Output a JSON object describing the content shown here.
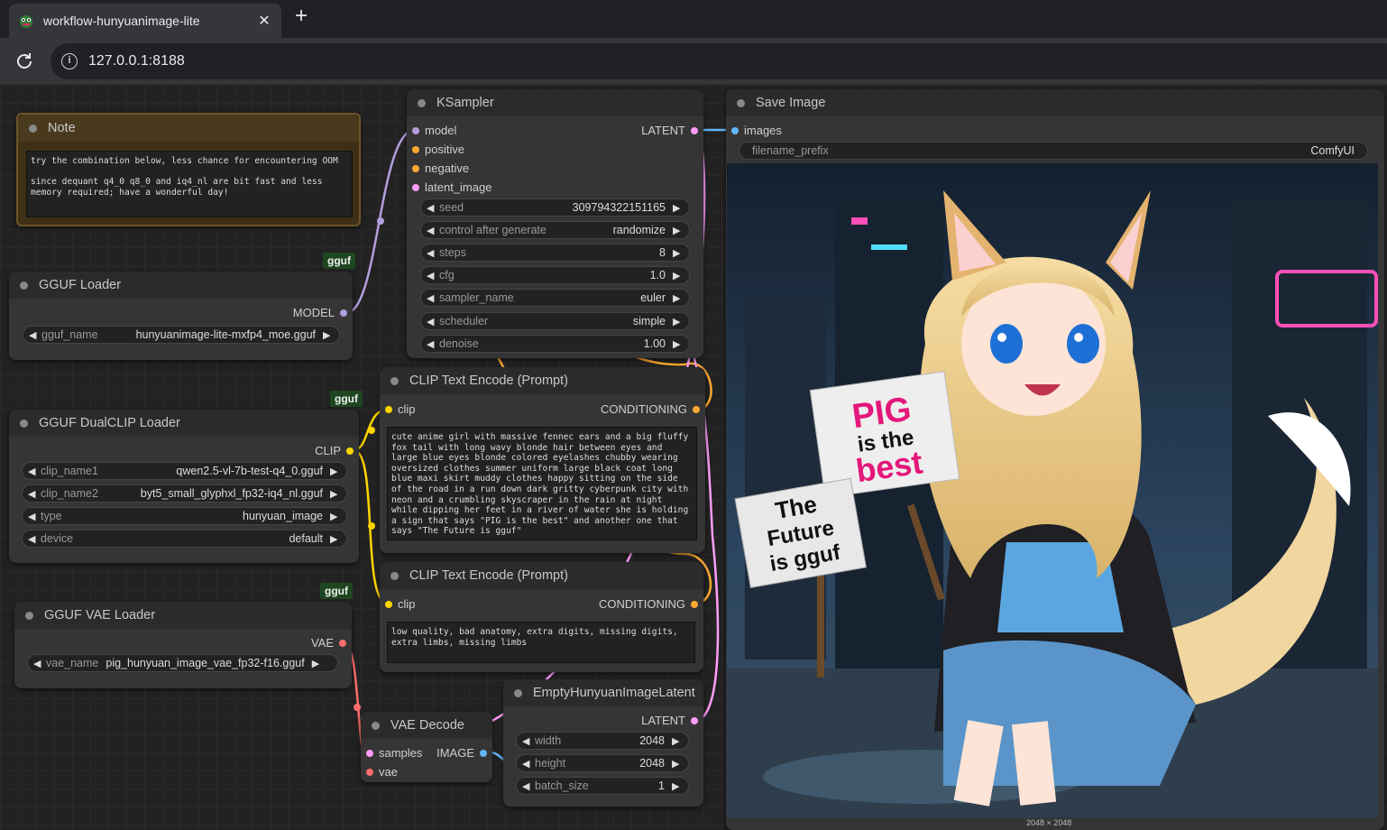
{
  "browser": {
    "tab_title": "workflow-hunyuanimage-lite",
    "close_glyph": "✕",
    "newtab_glyph": "+",
    "url": "127.0.0.1:8188",
    "info_glyph": "i"
  },
  "note": {
    "title": "Note",
    "text": "try the combination below, less chance for encountering OOM\n\nsince dequant q4_0 q8_0 and iq4_nl are bit fast and less\nmemory required; have a wonderful day!"
  },
  "badges": {
    "gguf": "gguf"
  },
  "gguf_loader": {
    "title": "GGUF Loader",
    "output": "MODEL",
    "widget_label": "gguf_name",
    "widget_value": "hunyuanimage-lite-mxfp4_moe.gguf"
  },
  "dualclip_loader": {
    "title": "GGUF DualCLIP Loader",
    "output": "CLIP",
    "widgets": [
      {
        "label": "clip_name1",
        "value": "qwen2.5-vl-7b-test-q4_0.gguf"
      },
      {
        "label": "clip_name2",
        "value": "byt5_small_glyphxl_fp32-iq4_nl.gguf"
      },
      {
        "label": "type",
        "value": "hunyuan_image"
      },
      {
        "label": "device",
        "value": "default"
      }
    ]
  },
  "vae_loader": {
    "title": "GGUF VAE Loader",
    "output": "VAE",
    "widget_label": "vae_name",
    "widget_value": "pig_hunyuan_image_vae_fp32-f16.gguf"
  },
  "ksampler": {
    "title": "KSampler",
    "inputs": [
      "model",
      "positive",
      "negative",
      "latent_image"
    ],
    "output": "LATENT",
    "widgets": [
      {
        "label": "seed",
        "value": "309794322151165"
      },
      {
        "label": "control after generate",
        "value": "randomize"
      },
      {
        "label": "steps",
        "value": "8"
      },
      {
        "label": "cfg",
        "value": "1.0"
      },
      {
        "label": "sampler_name",
        "value": "euler"
      },
      {
        "label": "scheduler",
        "value": "simple"
      },
      {
        "label": "denoise",
        "value": "1.00"
      }
    ]
  },
  "clip_pos": {
    "title": "CLIP Text Encode (Prompt)",
    "input": "clip",
    "output": "CONDITIONING",
    "text": "cute anime girl with massive fennec ears and a big fluffy fox tail with long wavy blonde hair between eyes and large blue eyes blonde colored eyelashes chubby wearing oversized clothes summer uniform large black coat long blue maxi skirt muddy clothes happy sitting on the side of the road in a run down dark gritty cyberpunk city with neon and a crumbling skyscraper in the rain at night while dipping her feet in a river of water she is holding a sign that says \"PIG is the best\" and another one that says \"The Future is gguf\""
  },
  "clip_neg": {
    "title": "CLIP Text Encode (Prompt)",
    "input": "clip",
    "output": "CONDITIONING",
    "text": "low quality, bad anatomy, extra digits, missing digits, extra limbs, missing limbs"
  },
  "vae_decode": {
    "title": "VAE Decode",
    "inputs": [
      "samples",
      "vae"
    ],
    "output": "IMAGE"
  },
  "empty_latent": {
    "title": "EmptyHunyuanImageLatent",
    "output": "LATENT",
    "widgets": [
      {
        "label": "width",
        "value": "2048"
      },
      {
        "label": "height",
        "value": "2048"
      },
      {
        "label": "batch_size",
        "value": "1"
      }
    ]
  },
  "save_image": {
    "title": "Save Image",
    "input": "images",
    "widget_label": "filename_prefix",
    "widget_value": "ComfyUI",
    "dims": "2048 × 2048",
    "sign1": [
      "PIG",
      "is the",
      "best"
    ],
    "sign2": [
      "The",
      "Future",
      "is gguf"
    ]
  },
  "colors": {
    "model": "#b39ddb",
    "clip": "#ffd500",
    "conditioning": "#ffa931",
    "latent": "#ff9cf9",
    "vae": "#ff6e6e",
    "image": "#64b5f6"
  }
}
